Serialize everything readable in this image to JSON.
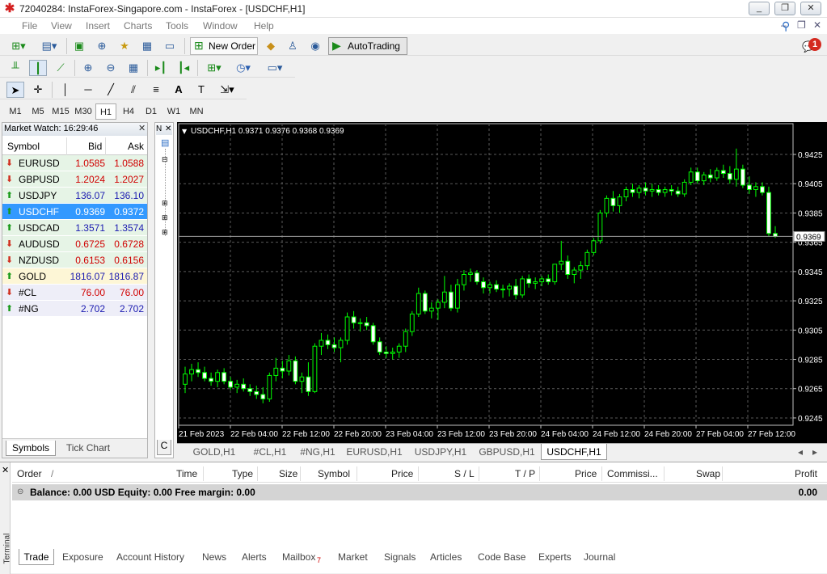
{
  "window": {
    "title": "72040284: InstaForex-Singapore.com - InstaForex - [USDCHF,H1]",
    "minimize": "_",
    "restore": "❐",
    "close": "✕"
  },
  "menu": {
    "items": [
      "File",
      "View",
      "Insert",
      "Charts",
      "Tools",
      "Window",
      "Help"
    ],
    "mdi_min": "–",
    "mdi_restore": "❐",
    "mdi_close": "✕"
  },
  "notifications": {
    "count": "1"
  },
  "toolbar": {
    "new_order": "New Order",
    "autotrading": "AutoTrading"
  },
  "timeframes": {
    "items": [
      "M1",
      "M5",
      "M15",
      "M30",
      "H1",
      "H4",
      "D1",
      "W1",
      "MN"
    ],
    "active": "H1"
  },
  "market_watch": {
    "header": "Market Watch: 16:29:46",
    "close": "✕",
    "columns": {
      "symbol": "Symbol",
      "bid": "Bid",
      "ask": "Ask"
    },
    "rows": [
      {
        "symbol": "EURUSD",
        "bid": "1.0585",
        "ask": "1.0588",
        "dir": "down",
        "color": "#d00000",
        "bg": "#e6f4e6"
      },
      {
        "symbol": "GBPUSD",
        "bid": "1.2024",
        "ask": "1.2027",
        "dir": "down",
        "color": "#d00000",
        "bg": "#e6f4e6"
      },
      {
        "symbol": "USDJPY",
        "bid": "136.07",
        "ask": "136.10",
        "dir": "up",
        "color": "#1a1ab0",
        "bg": "#e6f4e6"
      },
      {
        "symbol": "USDCHF",
        "bid": "0.9369",
        "ask": "0.9372",
        "dir": "up",
        "color": "#ffffff",
        "bg": "#3399ff"
      },
      {
        "symbol": "USDCAD",
        "bid": "1.3571",
        "ask": "1.3574",
        "dir": "up",
        "color": "#1a1ab0",
        "bg": "#e6f4e6"
      },
      {
        "symbol": "AUDUSD",
        "bid": "0.6725",
        "ask": "0.6728",
        "dir": "down",
        "color": "#d00000",
        "bg": "#e6f4e6"
      },
      {
        "symbol": "NZDUSD",
        "bid": "0.6153",
        "ask": "0.6156",
        "dir": "down",
        "color": "#d00000",
        "bg": "#e6f4e6"
      },
      {
        "symbol": "GOLD",
        "bid": "1816.07",
        "ask": "1816.87",
        "dir": "up",
        "color": "#1a1ab0",
        "bg": "#fdf6d6"
      },
      {
        "symbol": "#CL",
        "bid": "76.00",
        "ask": "76.00",
        "dir": "down",
        "color": "#d00000",
        "bg": "#eeeef8"
      },
      {
        "symbol": "#NG",
        "bid": "2.702",
        "ask": "2.702",
        "dir": "up",
        "color": "#1a1ab0",
        "bg": "#eeeef8"
      }
    ],
    "tabs": [
      "Symbols",
      "Tick Chart"
    ]
  },
  "navigator": {
    "label": "N",
    "close": "✕",
    "tab": "C"
  },
  "chart_data": {
    "type": "candlestick",
    "title": "USDCHF,H1  0.9371 0.9376 0.9368 0.9369",
    "symbol": "USDCHF",
    "timeframe": "H1",
    "ohlc_header": {
      "open": "0.9371",
      "high": "0.9376",
      "low": "0.9368",
      "close": "0.9369"
    },
    "current_price": "0.9369",
    "ylim": [
      0.924,
      0.9446
    ],
    "y_ticks": [
      "0.9425",
      "0.9405",
      "0.9385",
      "0.9365",
      "0.9345",
      "0.9325",
      "0.9305",
      "0.9285",
      "0.9265",
      "0.9245"
    ],
    "x_ticks": [
      "21 Feb 2023",
      "22 Feb 04:00",
      "22 Feb 12:00",
      "22 Feb 20:00",
      "23 Feb 04:00",
      "23 Feb 12:00",
      "23 Feb 20:00",
      "24 Feb 04:00",
      "24 Feb 12:00",
      "24 Feb 20:00",
      "27 Feb 04:00",
      "27 Feb 12:00"
    ],
    "candles": [
      [
        0.9268,
        0.928,
        0.9262,
        0.9275
      ],
      [
        0.9275,
        0.9282,
        0.927,
        0.9278
      ],
      [
        0.9278,
        0.9283,
        0.9273,
        0.9276
      ],
      [
        0.9276,
        0.928,
        0.927,
        0.9272
      ],
      [
        0.9272,
        0.9276,
        0.9267,
        0.927
      ],
      [
        0.927,
        0.9278,
        0.9266,
        0.9276
      ],
      [
        0.9276,
        0.9279,
        0.9268,
        0.927
      ],
      [
        0.927,
        0.9273,
        0.9264,
        0.9266
      ],
      [
        0.9266,
        0.9271,
        0.9262,
        0.9268
      ],
      [
        0.9268,
        0.9272,
        0.9263,
        0.9265
      ],
      [
        0.9265,
        0.9268,
        0.926,
        0.9263
      ],
      [
        0.9263,
        0.9267,
        0.9258,
        0.9261
      ],
      [
        0.9261,
        0.9266,
        0.9255,
        0.9258
      ],
      [
        0.9258,
        0.9276,
        0.9256,
        0.9274
      ],
      [
        0.9274,
        0.9286,
        0.927,
        0.9279
      ],
      [
        0.9279,
        0.9284,
        0.9272,
        0.9277
      ],
      [
        0.9277,
        0.9288,
        0.9274,
        0.9284
      ],
      [
        0.9284,
        0.9287,
        0.9268,
        0.927
      ],
      [
        0.927,
        0.9276,
        0.9262,
        0.9273
      ],
      [
        0.9273,
        0.9283,
        0.926,
        0.9263
      ],
      [
        0.9263,
        0.9296,
        0.9262,
        0.9294
      ],
      [
        0.9294,
        0.9303,
        0.9288,
        0.9298
      ],
      [
        0.9298,
        0.9302,
        0.9292,
        0.9295
      ],
      [
        0.9295,
        0.93,
        0.929,
        0.9293
      ],
      [
        0.9293,
        0.93,
        0.9283,
        0.9298
      ],
      [
        0.9298,
        0.9317,
        0.9295,
        0.9314
      ],
      [
        0.9314,
        0.9318,
        0.9306,
        0.931
      ],
      [
        0.931,
        0.9313,
        0.9304,
        0.931
      ],
      [
        0.931,
        0.9314,
        0.9305,
        0.9308
      ],
      [
        0.9308,
        0.931,
        0.9295,
        0.9297
      ],
      [
        0.9297,
        0.93,
        0.9288,
        0.929
      ],
      [
        0.929,
        0.9294,
        0.9286,
        0.9289
      ],
      [
        0.9289,
        0.9293,
        0.9285,
        0.929
      ],
      [
        0.929,
        0.9296,
        0.9286,
        0.9294
      ],
      [
        0.9294,
        0.9306,
        0.929,
        0.9304
      ],
      [
        0.9304,
        0.9318,
        0.9301,
        0.9316
      ],
      [
        0.9316,
        0.9334,
        0.9314,
        0.933
      ],
      [
        0.933,
        0.9332,
        0.9316,
        0.9318
      ],
      [
        0.9318,
        0.9324,
        0.9313,
        0.932
      ],
      [
        0.932,
        0.9326,
        0.9312,
        0.9324
      ],
      [
        0.9324,
        0.9342,
        0.932,
        0.9331
      ],
      [
        0.9331,
        0.9336,
        0.9318,
        0.932
      ],
      [
        0.932,
        0.934,
        0.9317,
        0.9336
      ],
      [
        0.9336,
        0.9346,
        0.9332,
        0.9343
      ],
      [
        0.9343,
        0.9347,
        0.9338,
        0.9344
      ],
      [
        0.9344,
        0.9346,
        0.9336,
        0.9338
      ],
      [
        0.9338,
        0.9341,
        0.933,
        0.9334
      ],
      [
        0.9334,
        0.9338,
        0.933,
        0.9336
      ],
      [
        0.9336,
        0.9339,
        0.9331,
        0.9333
      ],
      [
        0.9333,
        0.9336,
        0.9327,
        0.9333
      ],
      [
        0.9333,
        0.9337,
        0.9328,
        0.9335
      ],
      [
        0.9335,
        0.934,
        0.9326,
        0.9329
      ],
      [
        0.9329,
        0.9342,
        0.9327,
        0.934
      ],
      [
        0.934,
        0.9343,
        0.9334,
        0.9337
      ],
      [
        0.9337,
        0.9341,
        0.9333,
        0.9338
      ],
      [
        0.9338,
        0.9342,
        0.9335,
        0.934
      ],
      [
        0.934,
        0.9343,
        0.9336,
        0.9338
      ],
      [
        0.9338,
        0.935,
        0.9336,
        0.935
      ],
      [
        0.935,
        0.9366,
        0.9346,
        0.9352
      ],
      [
        0.9352,
        0.9356,
        0.934,
        0.9343
      ],
      [
        0.9343,
        0.9348,
        0.9337,
        0.9346
      ],
      [
        0.9346,
        0.9352,
        0.934,
        0.9349
      ],
      [
        0.9349,
        0.936,
        0.9346,
        0.9358
      ],
      [
        0.9358,
        0.9368,
        0.9356,
        0.9366
      ],
      [
        0.9366,
        0.9387,
        0.9364,
        0.9385
      ],
      [
        0.9385,
        0.9397,
        0.9382,
        0.9395
      ],
      [
        0.9395,
        0.94,
        0.9386,
        0.939
      ],
      [
        0.939,
        0.9398,
        0.9385,
        0.9396
      ],
      [
        0.9396,
        0.9403,
        0.9393,
        0.9401
      ],
      [
        0.9401,
        0.9405,
        0.9396,
        0.9399
      ],
      [
        0.9399,
        0.9404,
        0.9395,
        0.9402
      ],
      [
        0.9402,
        0.9406,
        0.9397,
        0.94
      ],
      [
        0.94,
        0.9405,
        0.9396,
        0.9401
      ],
      [
        0.9401,
        0.9404,
        0.9397,
        0.9399
      ],
      [
        0.9399,
        0.9403,
        0.9396,
        0.9401
      ],
      [
        0.9401,
        0.9404,
        0.9397,
        0.94
      ],
      [
        0.94,
        0.9403,
        0.9396,
        0.9398
      ],
      [
        0.9398,
        0.9408,
        0.9396,
        0.9406
      ],
      [
        0.9406,
        0.9416,
        0.9404,
        0.9413
      ],
      [
        0.9413,
        0.9416,
        0.9405,
        0.9407
      ],
      [
        0.9407,
        0.9413,
        0.9404,
        0.9411
      ],
      [
        0.9411,
        0.9415,
        0.9406,
        0.9409
      ],
      [
        0.9409,
        0.9416,
        0.9407,
        0.9414
      ],
      [
        0.9414,
        0.9418,
        0.9409,
        0.9412
      ],
      [
        0.9412,
        0.9417,
        0.9405,
        0.9408
      ],
      [
        0.9408,
        0.9429,
        0.9403,
        0.9415
      ],
      [
        0.9415,
        0.9418,
        0.9402,
        0.9404
      ],
      [
        0.9404,
        0.941,
        0.9398,
        0.9401
      ],
      [
        0.9401,
        0.9406,
        0.9396,
        0.9403
      ],
      [
        0.9403,
        0.9406,
        0.9397,
        0.9399
      ],
      [
        0.9399,
        0.9403,
        0.9369,
        0.9371
      ],
      [
        0.9371,
        0.9376,
        0.9368,
        0.9369
      ]
    ]
  },
  "chart_tabs": {
    "items": [
      "GOLD,H1",
      "#CL,H1",
      "#NG,H1",
      "EURUSD,H1",
      "USDJPY,H1",
      "GBPUSD,H1",
      "USDCHF,H1"
    ],
    "active": "USDCHF,H1",
    "scroll_left": "◂",
    "scroll_right": "▸"
  },
  "terminal": {
    "label": "Terminal",
    "close": "✕",
    "columns": [
      "Order",
      "/",
      "Time",
      "Type",
      "Size",
      "Symbol",
      "Price",
      "S / L",
      "T / P",
      "Price",
      "Commissi...",
      "Swap",
      "Profit"
    ],
    "balance_text": "Balance: 0.00 USD  Equity: 0.00  Free margin: 0.00",
    "balance_profit": "0.00",
    "tabs": [
      "Trade",
      "Exposure",
      "Account History",
      "News",
      "Alerts",
      "Mailbox",
      "Market",
      "Signals",
      "Articles",
      "Code Base",
      "Experts",
      "Journal"
    ],
    "mailbox_badge": "7",
    "active_tab": "Trade"
  }
}
